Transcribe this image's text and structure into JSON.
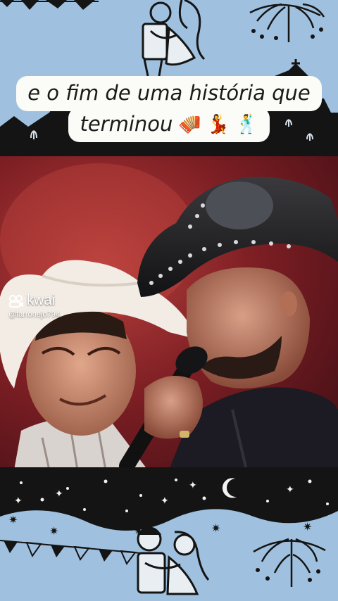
{
  "caption": {
    "line1": "e o fim de uma história que",
    "line2": "terminou",
    "emojis": [
      "🪗",
      "💃",
      "🕺"
    ]
  },
  "watermark": {
    "brand": "kwai",
    "handle": "@farronejo794",
    "icon": "kwai-logo-icon"
  },
  "colors": {
    "background": "#9fc1df",
    "caption_bg": "#fbfbf7",
    "silhouette": "#141414",
    "stage_red": "#a0302f"
  }
}
